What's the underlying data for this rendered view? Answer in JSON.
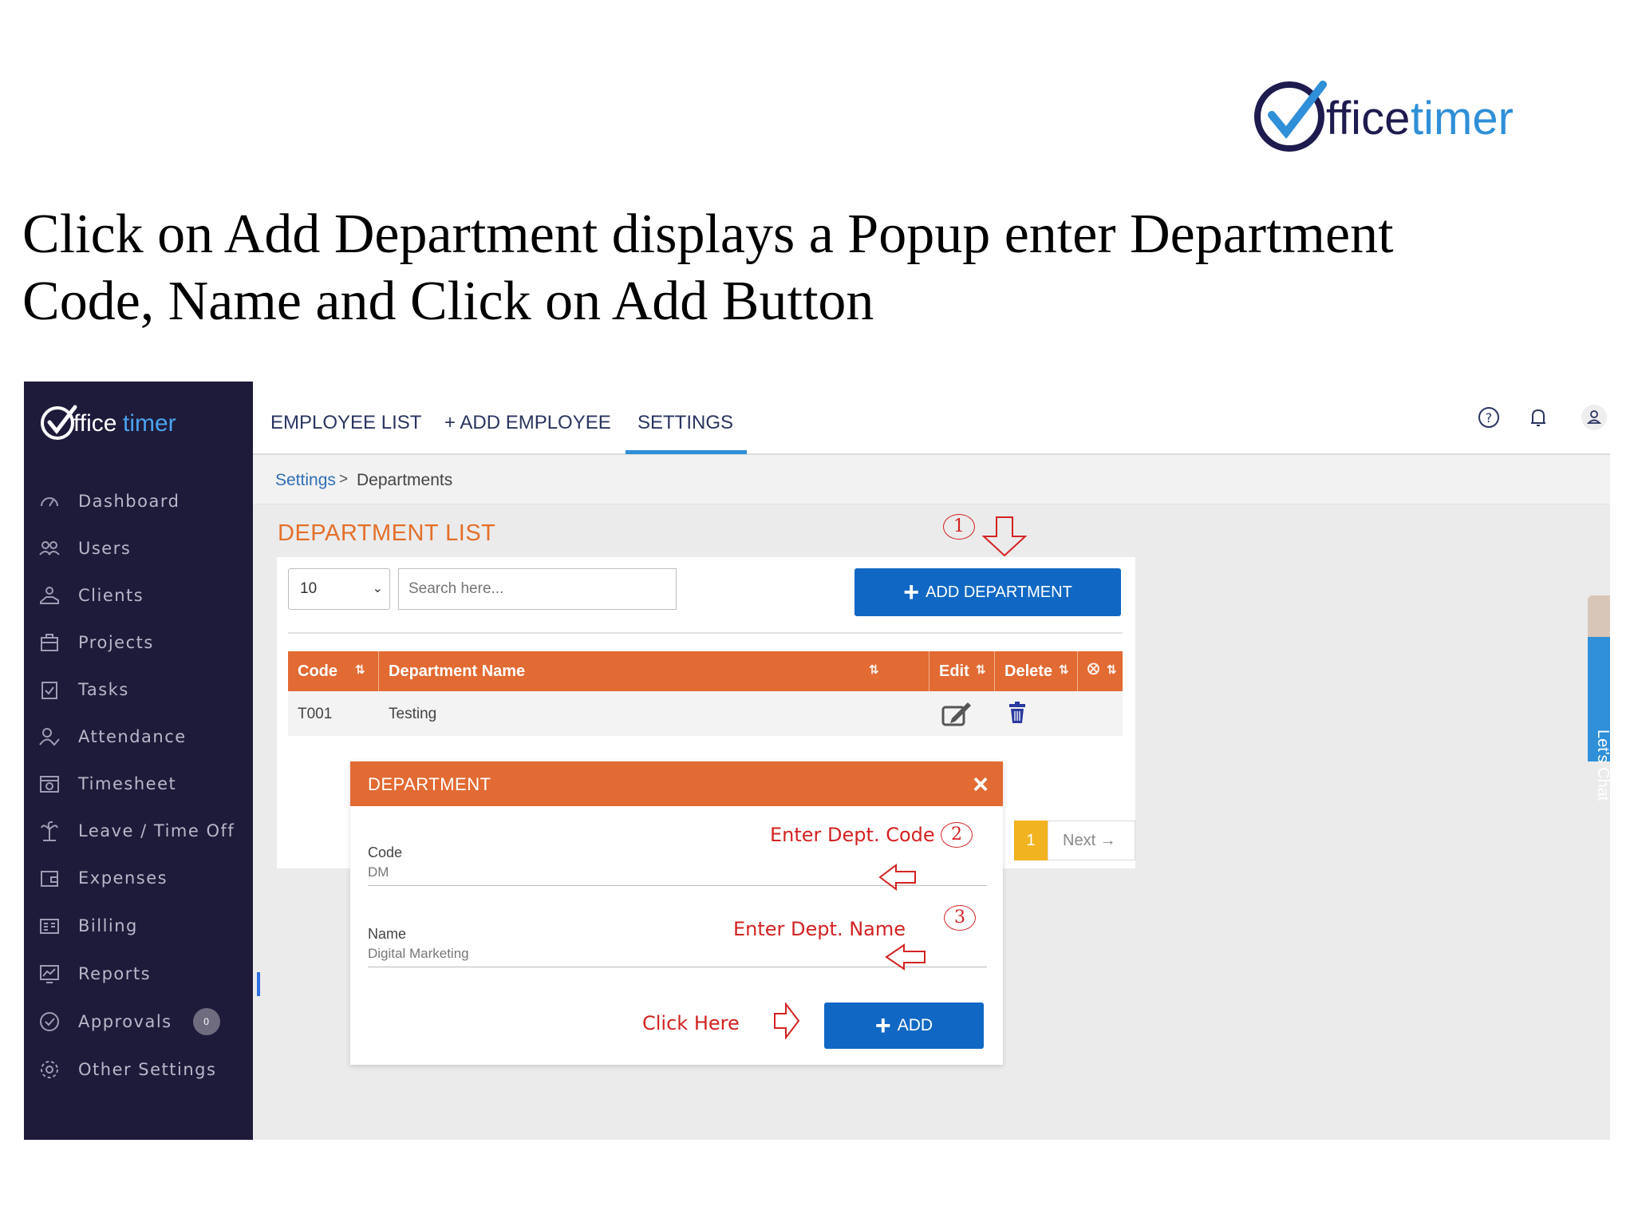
{
  "brand": {
    "name_part1": "ffice",
    "name_part2": "timer"
  },
  "headline": "Click on Add Department displays a Popup enter Department Code, Name and Click on Add Button",
  "sidebar": {
    "items": [
      {
        "label": "Dashboard",
        "icon": "dashboard-icon"
      },
      {
        "label": "Users",
        "icon": "users-icon"
      },
      {
        "label": "Clients",
        "icon": "clients-icon"
      },
      {
        "label": "Projects",
        "icon": "projects-icon"
      },
      {
        "label": "Tasks",
        "icon": "tasks-icon"
      },
      {
        "label": "Attendance",
        "icon": "attendance-icon"
      },
      {
        "label": "Timesheet",
        "icon": "timesheet-icon"
      },
      {
        "label": "Leave / Time Off",
        "icon": "leave-icon"
      },
      {
        "label": "Expenses",
        "icon": "expenses-icon"
      },
      {
        "label": "Billing",
        "icon": "billing-icon"
      },
      {
        "label": "Reports",
        "icon": "reports-icon"
      },
      {
        "label": "Approvals",
        "icon": "approvals-icon",
        "badge": "0"
      },
      {
        "label": "Other Settings",
        "icon": "settings-icon"
      }
    ]
  },
  "tabs": [
    {
      "label": "EMPLOYEE LIST"
    },
    {
      "label": "+ ADD EMPLOYEE"
    },
    {
      "label": "SETTINGS",
      "active": true
    }
  ],
  "breadcrumb": {
    "parent": "Settings",
    "separator": ">",
    "current": "Departments"
  },
  "page_title": "DEPARTMENT LIST",
  "controls": {
    "page_size": "10",
    "search_placeholder": "Search here...",
    "add_department": "ADD DEPARTMENT"
  },
  "table": {
    "columns": [
      "Code",
      "Department Name",
      "Edit",
      "Delete"
    ],
    "rows": [
      {
        "code": "T001",
        "name": "Testing"
      }
    ]
  },
  "pager": {
    "active_page": "1",
    "next": "Next →"
  },
  "modal": {
    "title": "DEPARTMENT",
    "close": "×",
    "code_label": "Code",
    "code_value": "DM",
    "name_label": "Name",
    "name_value": "Digital Marketing",
    "add_button": "ADD"
  },
  "annotations": {
    "step1": "1",
    "step2": "2",
    "step3": "3",
    "enter_code": "Enter Dept. Code",
    "enter_name": "Enter Dept. Name",
    "click_here": "Click Here"
  },
  "chat": {
    "label": "Let's Chat"
  },
  "colors": {
    "sidebar": "#1e1b3a",
    "accent_orange": "#e26a33",
    "primary_blue": "#1168c4",
    "annotation_red": "#d32222",
    "pager_yellow": "#f2b320"
  }
}
